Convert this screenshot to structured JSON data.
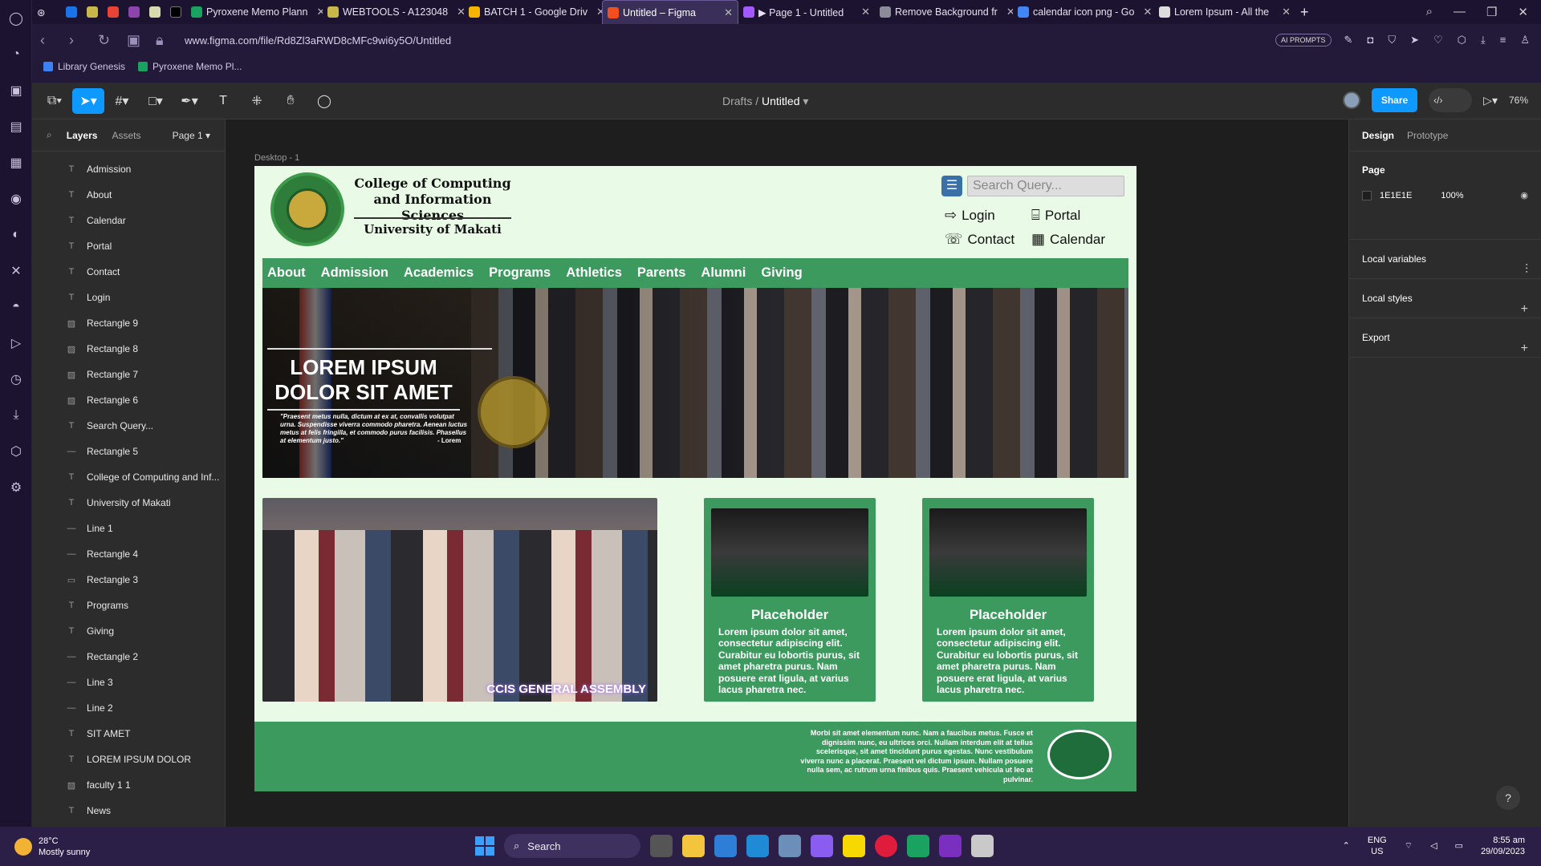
{
  "browser": {
    "tabs": [
      {
        "label": "Pyroxene Memo Plann",
        "color": "#1aa260"
      },
      {
        "label": "WEBTOOLS - A123048",
        "color": "#c8b84a"
      },
      {
        "label": "BATCH 1 - Google Driv",
        "color": "#f4b400"
      },
      {
        "label": "Untitled – Figma",
        "color": "#f24e1e",
        "active": true
      },
      {
        "label": "▶ Page 1 - Untitled",
        "color": "#a259ff"
      },
      {
        "label": "Remove Background fr",
        "color": "#8b8b9a"
      },
      {
        "label": "calendar icon png - Go",
        "color": "#4285f4"
      },
      {
        "label": "Lorem Ipsum - All the",
        "color": "#dddddd"
      }
    ],
    "url": "www.figma.com/file/Rd8Zl3aRWD8cMFc9wi6y5O/Untitled",
    "ai_badge": "AI PROMPTS",
    "bookmarks": [
      {
        "label": "Library Genesis",
        "color": "#3b82f6"
      },
      {
        "label": "Pyroxene Memo Pl...",
        "color": "#1aa260"
      }
    ]
  },
  "figma": {
    "breadcrumb_parent": "Drafts",
    "file_name": "Untitled",
    "share_label": "Share",
    "zoom": "76%",
    "left_tabs": {
      "layers": "Layers",
      "assets": "Assets",
      "page": "Page 1"
    },
    "layers": [
      {
        "name": "Admission",
        "icon": "T"
      },
      {
        "name": "About",
        "icon": "T"
      },
      {
        "name": "Calendar",
        "icon": "T"
      },
      {
        "name": "Portal",
        "icon": "T"
      },
      {
        "name": "Contact",
        "icon": "T"
      },
      {
        "name": "Login",
        "icon": "T"
      },
      {
        "name": "Rectangle 9",
        "icon": "▨"
      },
      {
        "name": "Rectangle 8",
        "icon": "▨"
      },
      {
        "name": "Rectangle 7",
        "icon": "▨"
      },
      {
        "name": "Rectangle 6",
        "icon": "▨"
      },
      {
        "name": "Search Query...",
        "icon": "T"
      },
      {
        "name": "Rectangle 5",
        "icon": "—"
      },
      {
        "name": "College of Computing and Inf...",
        "icon": "T"
      },
      {
        "name": "University of Makati",
        "icon": "T"
      },
      {
        "name": "Line 1",
        "icon": "—"
      },
      {
        "name": "Rectangle 4",
        "icon": "—"
      },
      {
        "name": "Rectangle 3",
        "icon": "▭"
      },
      {
        "name": "Programs",
        "icon": "T"
      },
      {
        "name": "Giving",
        "icon": "T"
      },
      {
        "name": "Rectangle 2",
        "icon": "—"
      },
      {
        "name": "Line 3",
        "icon": "—"
      },
      {
        "name": "Line 2",
        "icon": "—"
      },
      {
        "name": "SIT AMET",
        "icon": "T"
      },
      {
        "name": "LOREM IPSUM DOLOR",
        "icon": "T"
      },
      {
        "name": "faculty 1 1",
        "icon": "▨"
      },
      {
        "name": "News",
        "icon": "T"
      }
    ],
    "right_tabs": {
      "design": "Design",
      "prototype": "Prototype"
    },
    "page_section": {
      "title": "Page",
      "color_hex": "1E1E1E",
      "opacity": "100%"
    },
    "sections": [
      "Local variables",
      "Local styles",
      "Export"
    ],
    "frame_label": "Desktop - 1",
    "help": "?"
  },
  "design": {
    "college": "College of Computing and Information Sciences",
    "university": "University of Makati",
    "search_placeholder": "Search Query...",
    "quick_links": [
      "Login",
      "Portal",
      "Contact",
      "Calendar"
    ],
    "nav": [
      "About",
      "Admission",
      "Academics",
      "Programs",
      "Athletics",
      "Parents",
      "Alumni",
      "Giving"
    ],
    "hero_title": "LOREM IPSUM DOLOR SIT AMET",
    "hero_quote": "\"Praesent metus nulla, dictum at ex at, convallis volutpat urna. Suspendisse viverra commodo pharetra. Aenean luctus metus at felis fringilla, et commodo purus facilisis. Phasellus at elementum justo.\"",
    "hero_author": "- Lorem",
    "group_badge": "CCIS GENERAL ASSEMBLY",
    "cards": [
      {
        "title": "Placeholder",
        "text": "Lorem ipsum dolor sit amet, consectetur adipiscing elit. Curabitur eu lobortis purus, sit amet pharetra purus. Nam posuere erat ligula, at varius lacus pharetra nec."
      },
      {
        "title": "Placeholder",
        "text": "Lorem ipsum dolor sit amet, consectetur adipiscing elit. Curabitur eu lobortis purus, sit amet pharetra purus. Nam posuere erat ligula, at varius lacus pharetra nec."
      }
    ],
    "footer_text": "Morbi sit amet elementum nunc. Nam a faucibus metus. Fusce et dignissim nunc, eu ultrices orci. Nullam interdum elit at tellus scelerisque, sit amet tincidunt purus egestas. Nunc vestibulum viverra nunc a placerat. Praesent vel dictum ipsum. Nullam posuere nulla sem, ac rutrum urna finibus quis. Praesent vehicula ut leo at pulvinar.",
    "green": "#3d9a5e",
    "bg": "#e9fbe6"
  },
  "taskbar": {
    "temp": "28°C",
    "weather": "Mostly sunny",
    "search": "Search",
    "lang": "ENG",
    "region": "US",
    "time": "8:55 am",
    "date": "29/09/2023"
  }
}
